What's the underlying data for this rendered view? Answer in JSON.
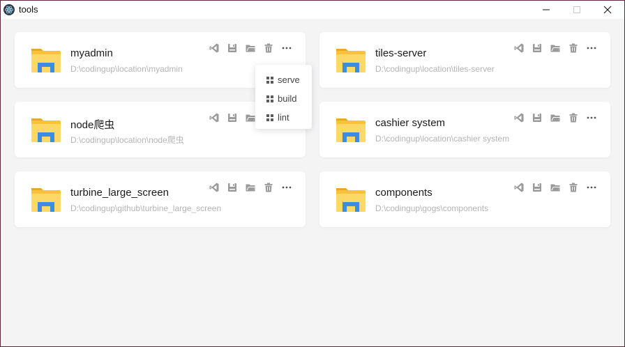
{
  "window": {
    "title": "tools"
  },
  "projects": [
    {
      "name": "myadmin",
      "path": "D:\\codingup\\location\\myadmin"
    },
    {
      "name": "tiles-server",
      "path": "D:\\codingup\\location\\tiles-server"
    },
    {
      "name": "node爬虫",
      "path": "D:\\codingup\\location\\node爬虫"
    },
    {
      "name": "cashier system",
      "path": "D:\\codingup\\location\\cashier system"
    },
    {
      "name": "turbine_large_screen",
      "path": "D:\\codingup\\github\\turbine_large_screen"
    },
    {
      "name": "components",
      "path": "D:\\codingup\\gogs\\components"
    }
  ],
  "actions": [
    "vscode-icon",
    "save-icon",
    "open-folder-icon",
    "trash-icon",
    "more-icon"
  ],
  "script_menu": {
    "items": [
      {
        "label": "serve"
      },
      {
        "label": "build"
      },
      {
        "label": "lint"
      }
    ]
  },
  "colors": {
    "folder_yellow": "#f8c33a",
    "folder_blue": "#3a8de0",
    "icon_gray": "#9a9a9a"
  }
}
